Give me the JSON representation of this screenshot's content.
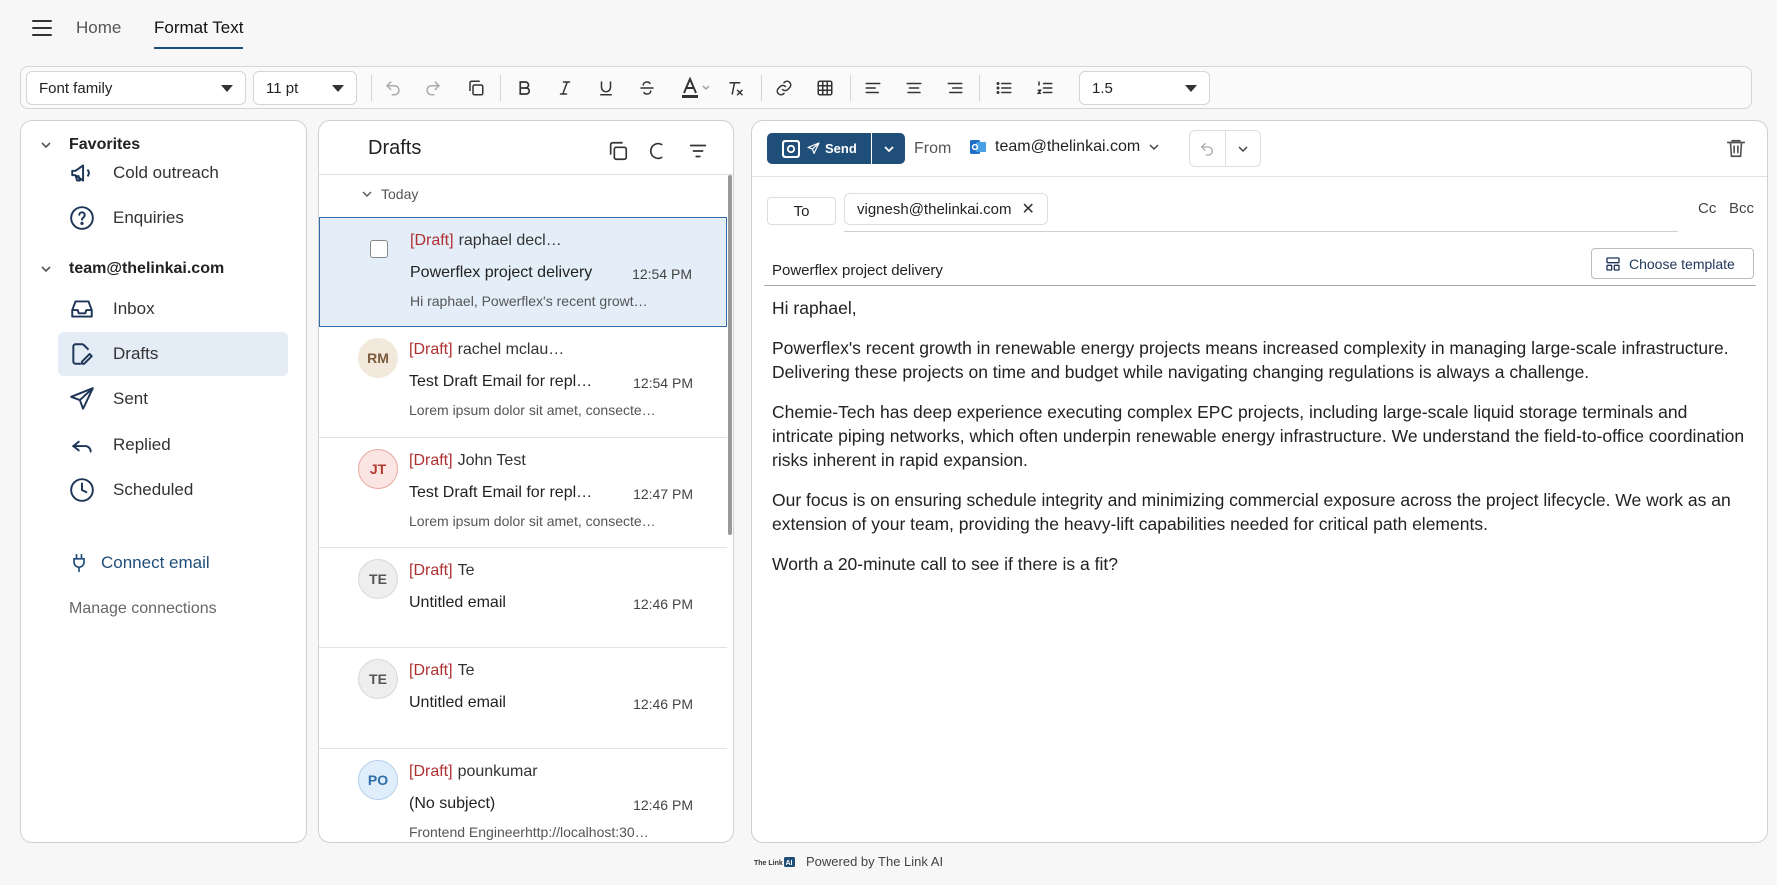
{
  "nav": {
    "tabs": [
      {
        "label": "Home"
      },
      {
        "label": "Format Text"
      }
    ]
  },
  "toolbar": {
    "font_family": "Font family",
    "font_size": "11 pt",
    "line_height": "1.5",
    "icons": [
      "undo-icon",
      "redo-icon",
      "copy-icon",
      "bold-icon",
      "italic-icon",
      "underline-icon",
      "strikethrough-icon",
      "text-color-icon",
      "clear-format-icon",
      "link-icon",
      "table-icon",
      "align-left-icon",
      "align-center-icon",
      "align-right-icon",
      "bullet-list-icon",
      "numbered-list-icon"
    ]
  },
  "sidebar": {
    "favorites_label": "Favorites",
    "favorites": [
      {
        "label": "Cold outreach",
        "icon": "megaphone-icon"
      },
      {
        "label": "Enquiries",
        "icon": "question-icon"
      }
    ],
    "account_label": "team@thelinkai.com",
    "folders": [
      {
        "label": "Inbox",
        "icon": "inbox-icon"
      },
      {
        "label": "Drafts",
        "icon": "drafts-icon"
      },
      {
        "label": "Sent",
        "icon": "send-icon"
      },
      {
        "label": "Replied",
        "icon": "reply-icon"
      },
      {
        "label": "Scheduled",
        "icon": "clock-icon"
      }
    ],
    "connect_email": "Connect email",
    "manage_connections": "Manage connections"
  },
  "drafts": {
    "title": "Drafts",
    "group": "Today",
    "items": [
      {
        "tag": "[Draft]",
        "name": "raphael decl…",
        "subject": "Powerflex project delivery",
        "time": "12:54 PM",
        "preview": "Hi raphael, Powerflex's recent growt…"
      },
      {
        "initials": "RM",
        "tag": "[Draft]",
        "name": "rachel mclau…",
        "subject": "Test Draft Email for repl…",
        "time": "12:54 PM",
        "preview": "Lorem ipsum dolor sit amet, consecte…"
      },
      {
        "initials": "JT",
        "tag": "[Draft]",
        "name": "John Test",
        "subject": "Test Draft Email for repl…",
        "time": "12:47 PM",
        "preview": "Lorem ipsum dolor sit amet, consecte…"
      },
      {
        "initials": "TE",
        "tag": "[Draft]",
        "name": "Te",
        "subject": "Untitled email",
        "time": "12:46 PM",
        "preview": ""
      },
      {
        "initials": "TE",
        "tag": "[Draft]",
        "name": "Te",
        "subject": "Untitled email",
        "time": "12:46 PM",
        "preview": ""
      },
      {
        "initials": "PO",
        "tag": "[Draft]",
        "name": "pounkumar",
        "subject": "(No subject)",
        "time": "12:46 PM",
        "preview": "Frontend Engineerhttp://localhost:30…"
      }
    ]
  },
  "compose": {
    "send_label": "Send",
    "from_label": "From",
    "from_account": "team@thelinkai.com",
    "to_label": "To",
    "recipient": "vignesh@thelinkai.com",
    "cc_label": "Cc",
    "bcc_label": "Bcc",
    "subject": "Powerflex project delivery",
    "template_label": "Choose template",
    "body": [
      "Hi raphael,",
      "Powerflex's recent growth in renewable energy projects means increased complexity in managing large-scale infrastructure. Delivering these projects on time and budget while navigating changing regulations is always a challenge.",
      "Chemie-Tech has deep experience executing complex EPC projects, including large-scale liquid storage terminals and intricate piping networks, which often underpin renewable energy infrastructure. We understand the field-to-office coordination risks inherent in rapid expansion.",
      "Our focus is on ensuring schedule integrity and minimizing commercial exposure across the project lifecycle. We work as an extension of your team, providing the heavy-lift capabilities needed for critical path elements.",
      "Worth a 20-minute call to see if there is a fit?"
    ]
  },
  "footer": {
    "logo_text": "The Link AI",
    "text": "Powered by The Link AI"
  },
  "colors": {
    "accent": "#1f4e79",
    "draft_tag": "#b03030",
    "selected_bg": "#e4ecf5"
  }
}
